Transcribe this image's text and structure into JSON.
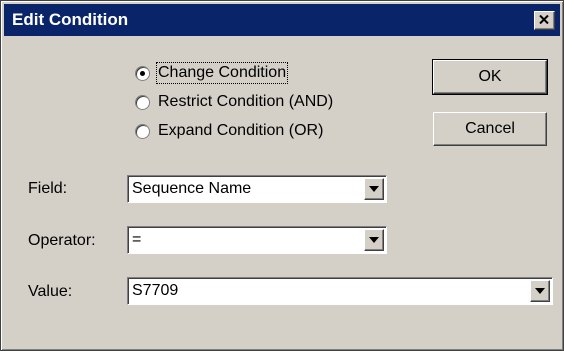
{
  "dialog": {
    "title": "Edit Condition",
    "close_glyph": "×"
  },
  "radio": {
    "options": [
      {
        "label": "Change Condition",
        "selected": true
      },
      {
        "label": "Restrict Condition (AND)",
        "selected": false
      },
      {
        "label": "Expand Condition (OR)",
        "selected": false
      }
    ]
  },
  "buttons": {
    "ok_label": "OK",
    "cancel_label": "Cancel"
  },
  "fields": {
    "field": {
      "label": "Field:",
      "value": "Sequence Name"
    },
    "operator": {
      "label": "Operator:",
      "value": "="
    },
    "value": {
      "label": "Value:",
      "value": "S7709"
    }
  },
  "colors": {
    "titlebar": "#0a246a",
    "face": "#d4d0c8",
    "input_bg": "#ffffff"
  },
  "icons": {
    "close": "close-icon",
    "dropdown": "chevron-down-icon"
  }
}
